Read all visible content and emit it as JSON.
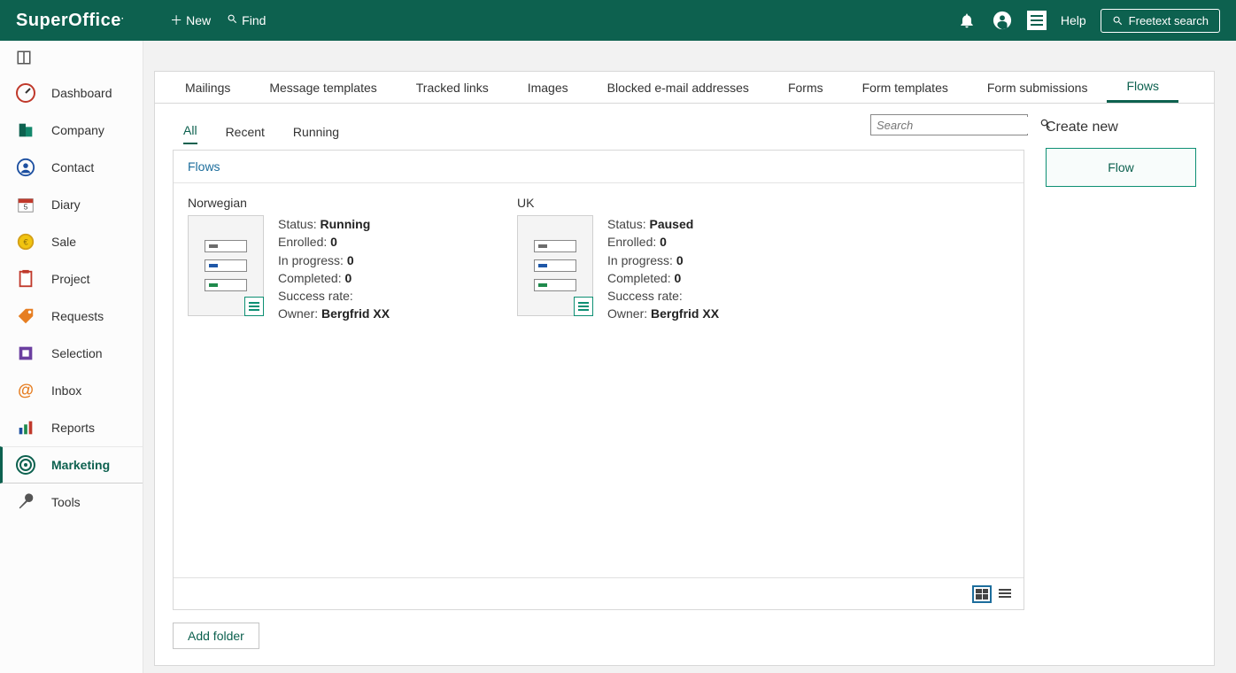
{
  "brand": {
    "name": "SuperOffice",
    "suffix": "."
  },
  "header": {
    "new": "New",
    "find": "Find",
    "help": "Help",
    "freetext": "Freetext search"
  },
  "sidebar": {
    "items": [
      {
        "label": "Dashboard"
      },
      {
        "label": "Company"
      },
      {
        "label": "Contact"
      },
      {
        "label": "Diary"
      },
      {
        "label": "Sale"
      },
      {
        "label": "Project"
      },
      {
        "label": "Requests"
      },
      {
        "label": "Selection"
      },
      {
        "label": "Inbox"
      },
      {
        "label": "Reports"
      },
      {
        "label": "Marketing"
      },
      {
        "label": "Tools"
      }
    ]
  },
  "tabs": {
    "items": [
      {
        "label": "Mailings"
      },
      {
        "label": "Message templates"
      },
      {
        "label": "Tracked links"
      },
      {
        "label": "Images"
      },
      {
        "label": "Blocked e-mail addresses"
      },
      {
        "label": "Forms"
      },
      {
        "label": "Form templates"
      },
      {
        "label": "Form submissions"
      },
      {
        "label": "Flows"
      }
    ]
  },
  "subtabs": {
    "items": [
      {
        "label": "All"
      },
      {
        "label": "Recent"
      },
      {
        "label": "Running"
      }
    ]
  },
  "search": {
    "placeholder": "Search"
  },
  "box": {
    "title": "Flows"
  },
  "labels": {
    "status": "Status:",
    "enrolled": "Enrolled:",
    "inprogress": "In progress:",
    "completed": "Completed:",
    "success": "Success rate:",
    "owner": "Owner:"
  },
  "flows": [
    {
      "name": "Norwegian",
      "status": "Running",
      "enrolled": "0",
      "inprogress": "0",
      "completed": "0",
      "success": "",
      "owner": "Bergfrid XX"
    },
    {
      "name": "UK",
      "status": "Paused",
      "enrolled": "0",
      "inprogress": "0",
      "completed": "0",
      "success": "",
      "owner": "Bergfrid XX"
    }
  ],
  "addFolder": "Add folder",
  "create": {
    "title": "Create new",
    "button": "Flow"
  }
}
